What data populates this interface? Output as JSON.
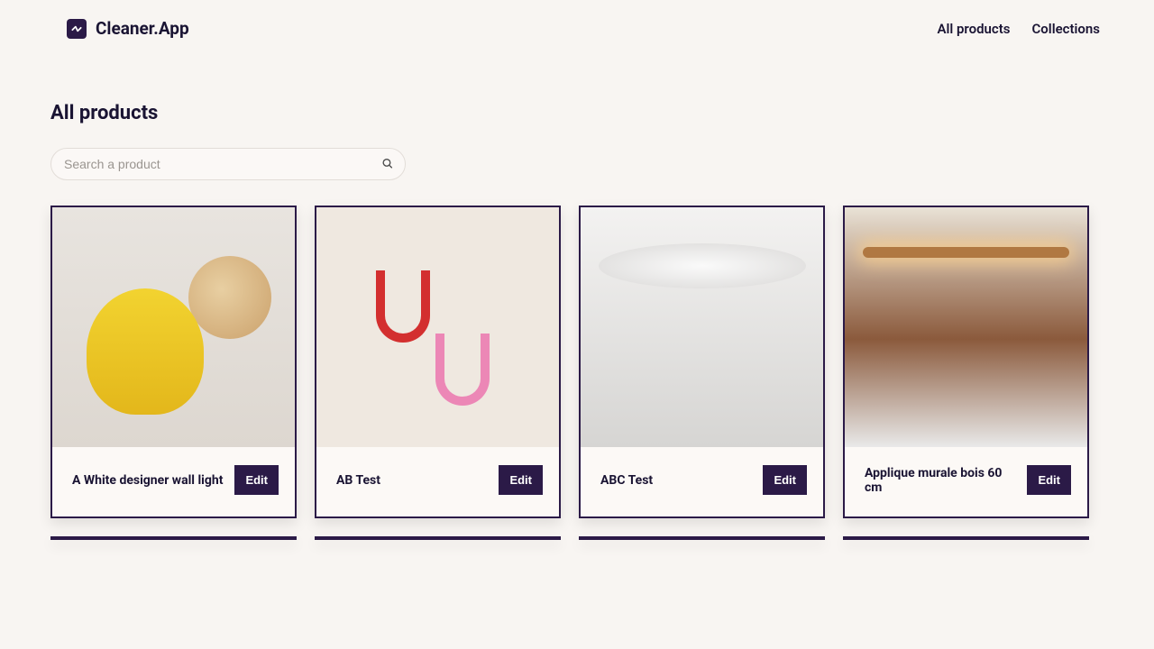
{
  "brand": {
    "name": "Cleaner.App"
  },
  "nav": {
    "all_products": "All products",
    "collections": "Collections"
  },
  "page": {
    "title": "All products"
  },
  "search": {
    "placeholder": "Search a product",
    "value": ""
  },
  "buttons": {
    "edit": "Edit"
  },
  "products": [
    {
      "title": "A White designer wall light"
    },
    {
      "title": "AB Test"
    },
    {
      "title": "ABC Test"
    },
    {
      "title": "Applique murale bois 60 cm"
    },
    {
      "title": ""
    },
    {
      "title": ""
    },
    {
      "title": ""
    },
    {
      "title": ""
    }
  ],
  "colors": {
    "accent": "#2b1a47",
    "background": "#f8f5f2"
  }
}
